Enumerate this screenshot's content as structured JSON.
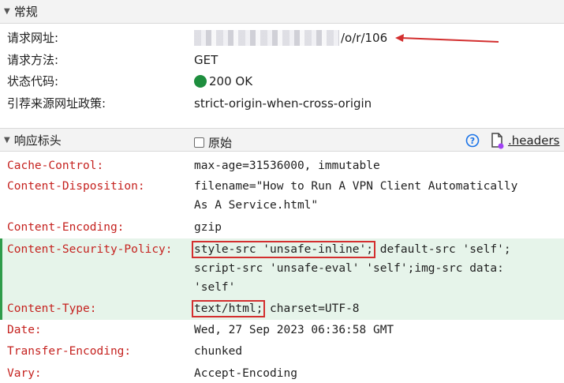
{
  "general": {
    "title": "常规",
    "rows": [
      {
        "key": "请求网址:",
        "value_suffix": "/o/r/106"
      },
      {
        "key": "请求方法:",
        "value": "GET"
      },
      {
        "key": "状态代码:",
        "value": "200 OK",
        "status_color": "#1e8e3e"
      },
      {
        "key": "引荐来源网址政策:",
        "value": "strict-origin-when-cross-origin"
      }
    ]
  },
  "response_headers": {
    "title": "响应标头",
    "raw_label": "原始",
    "headers_link": ".headers",
    "rows": [
      {
        "key": "Cache-Control:",
        "value": "max-age=31536000, immutable"
      },
      {
        "key": "Content-Disposition:",
        "value_lines": [
          "filename=\"How to Run A VPN Client Automatically",
          "As A Service.html\""
        ]
      },
      {
        "key": "Content-Encoding:",
        "value": "gzip"
      },
      {
        "key": "Content-Security-Policy:",
        "value_boxed": "style-src 'unsafe-inline';",
        "value_rest": " default-src 'self';",
        "value_lines": [
          "script-src 'unsafe-eval' 'self';img-src data:",
          "'self'"
        ]
      },
      {
        "key": "Content-Type:",
        "value_boxed": "text/html;",
        "value_rest": " charset=UTF-8"
      },
      {
        "key": "Date:",
        "value": "Wed, 27 Sep 2023 06:36:58 GMT"
      },
      {
        "key": "Transfer-Encoding:",
        "value": "chunked"
      },
      {
        "key": "Vary:",
        "value": "Accept-Encoding"
      }
    ]
  },
  "colors": {
    "key_red": "#c5221f",
    "highlight_bg": "#e6f4ea",
    "annotation_red": "#d32f2f",
    "link_blue": "#1a73e8"
  }
}
